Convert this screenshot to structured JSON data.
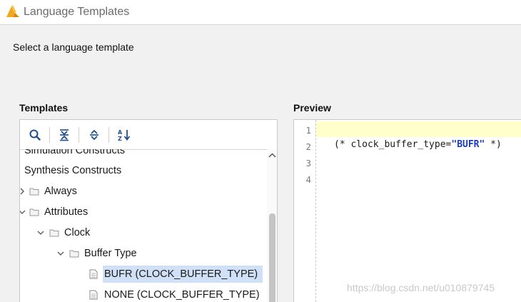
{
  "window": {
    "title": "Language Templates"
  },
  "instruction": "Select a language template",
  "templates": {
    "heading": "Templates",
    "toolbar": [
      {
        "name": "search-icon",
        "tooltip": "Search"
      },
      {
        "name": "collapse-all-icon",
        "tooltip": "Collapse All"
      },
      {
        "name": "expand-all-icon",
        "tooltip": "Expand All"
      },
      {
        "name": "sort-az-icon",
        "tooltip": "Sort"
      }
    ],
    "tree": {
      "simulation_constructs": "Simulation Constructs",
      "synthesis_constructs": "Synthesis Constructs",
      "always": "Always",
      "attributes": "Attributes",
      "clock": "Clock",
      "buffer_type": "Buffer Type",
      "bufr": "BUFR (CLOCK_BUFFER_TYPE)",
      "none": "NONE (CLOCK_BUFFER_TYPE)"
    },
    "selected_item": "BUFR (CLOCK_BUFFER_TYPE)"
  },
  "preview": {
    "heading": "Preview",
    "line_numbers": [
      "1",
      "2",
      "3",
      "4"
    ],
    "code_line2_prefix": "(* clock_buffer_type=",
    "code_line2_string": "\"BUFR\"",
    "code_line2_suffix": " *)"
  },
  "watermark": "https://blog.csdn.net/u010879745",
  "colors": {
    "selection": "#cfe0f7",
    "current_line": "#ffffcc",
    "string_literal": "#1a3cc4",
    "logo": "#f2a81d"
  }
}
